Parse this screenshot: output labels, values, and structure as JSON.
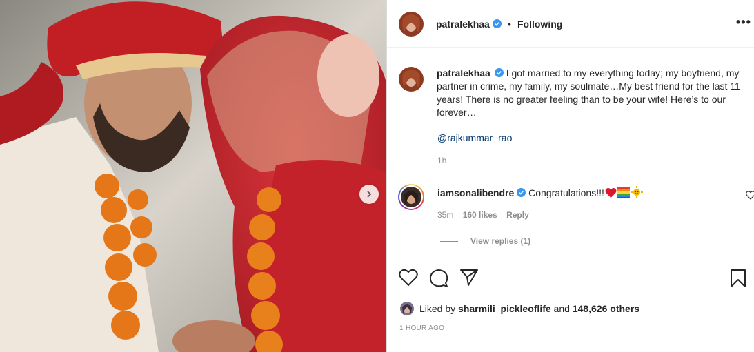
{
  "post": {
    "username": "patralekhaa",
    "follow_status": "Following",
    "more_label": "•••",
    "separator": "•"
  },
  "caption": {
    "username": "patralekhaa",
    "text": "I got married to my everything today; my boyfriend, my partner in crime, my family, my soulmate…My best friend for the last 11 years! There is no greater feeling than to be your wife! Here’s to our forever…",
    "mention": "@rajkummar_rao",
    "time": "1h"
  },
  "comment": {
    "username": "iamsonalibendre",
    "text": "Congratulations!!!",
    "emojis": [
      "heart-emoji",
      "rainbow-emoji",
      "sun-emoji"
    ],
    "time": "35m",
    "likes": "160 likes",
    "reply_label": "Reply",
    "view_replies": "View replies (1)"
  },
  "actions": {
    "icons": [
      "heart-icon",
      "comment-icon",
      "share-icon",
      "bookmark-icon"
    ]
  },
  "likes": {
    "prefix": "Liked by",
    "liker": "sharmili_pickleoflife",
    "joiner": "and",
    "count": "148,626 others"
  },
  "posted_time": "1 HOUR AGO",
  "colors": {
    "verified": "#3897f0",
    "link": "#00376b",
    "muted": "#8e8e8e",
    "text": "#262626"
  }
}
